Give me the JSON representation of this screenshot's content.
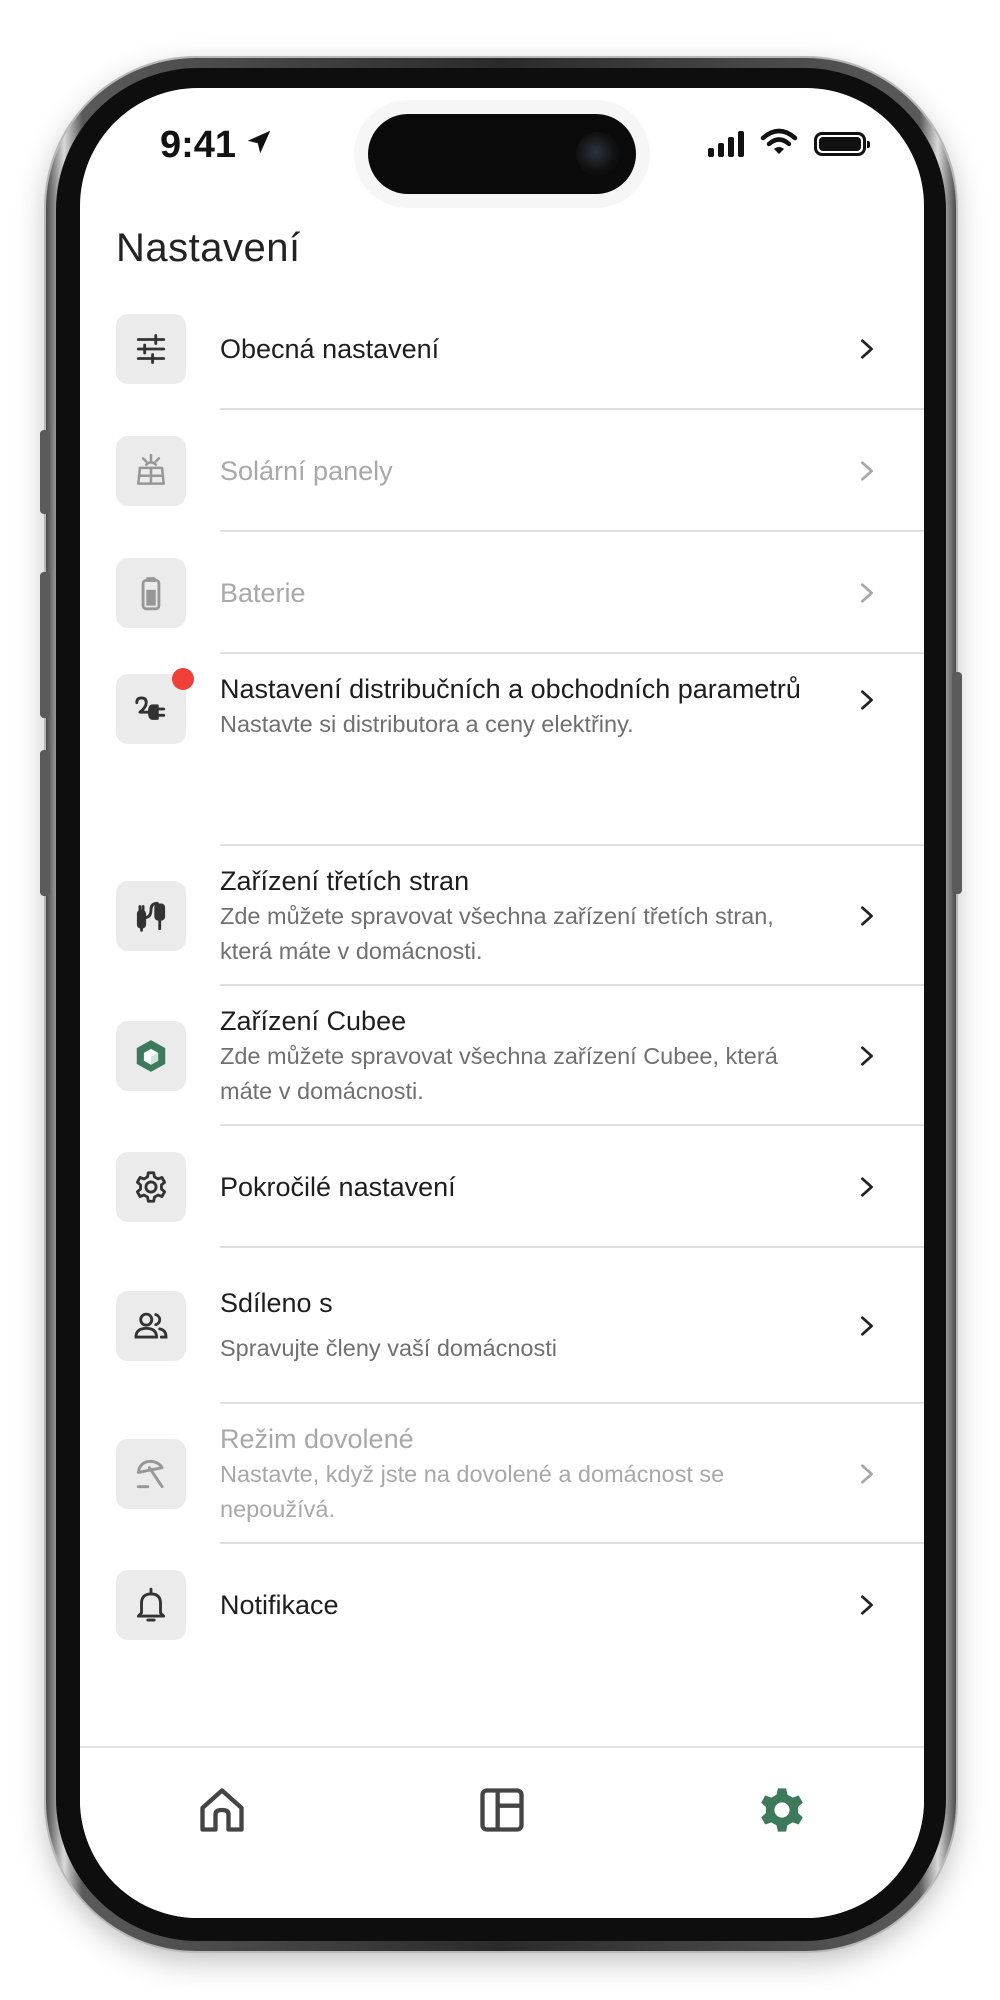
{
  "status_bar": {
    "time": "9:41"
  },
  "page": {
    "title": "Nastavení"
  },
  "settings": [
    {
      "title": "Obecná nastavení",
      "subtitle": "",
      "icon": "sliders-icon",
      "disabled": false
    },
    {
      "title": "Solární panely",
      "subtitle": "",
      "icon": "solar-panel-icon",
      "disabled": true
    },
    {
      "title": "Baterie",
      "subtitle": "",
      "icon": "battery-icon",
      "disabled": true
    },
    {
      "title": "Nastavení distribučních a obchodních parametrů",
      "subtitle": "Nastavte si distributora a ceny elektřiny.",
      "icon": "plug-icon",
      "disabled": false,
      "badge": true
    },
    {
      "title": "Zařízení třetích stran",
      "subtitle": "Zde můžete spravovat všechna zařízení třetích stran, která máte v domácnosti.",
      "icon": "devices-cable-icon",
      "disabled": false
    },
    {
      "title": "Zařízení Cubee",
      "subtitle": "Zde můžete spravovat všechna zařízení Cubee, která máte v domácnosti.",
      "icon": "cubee-icon",
      "disabled": false
    },
    {
      "title": "Pokročilé nastavení",
      "subtitle": "",
      "icon": "gear-icon",
      "disabled": false
    },
    {
      "title": "Sdíleno s",
      "subtitle": "Spravujte členy vaší domácnosti",
      "icon": "users-icon",
      "disabled": false
    },
    {
      "title": "Režim dovolené",
      "subtitle": "Nastavte, když jste na dovolené a domácnost se nepoužívá.",
      "icon": "beach-umbrella-icon",
      "disabled": true
    },
    {
      "title": "Notifikace",
      "subtitle": "",
      "icon": "bell-icon",
      "disabled": false
    }
  ],
  "tabbar": {
    "tabs": [
      {
        "icon": "home-icon",
        "active": false
      },
      {
        "icon": "dashboard-icon",
        "active": false
      },
      {
        "icon": "gear-icon",
        "active": true
      }
    ]
  },
  "colors": {
    "accent": "#3d7a5c",
    "badge": "#ee4038",
    "disabled_text": "#a8a8a8"
  }
}
